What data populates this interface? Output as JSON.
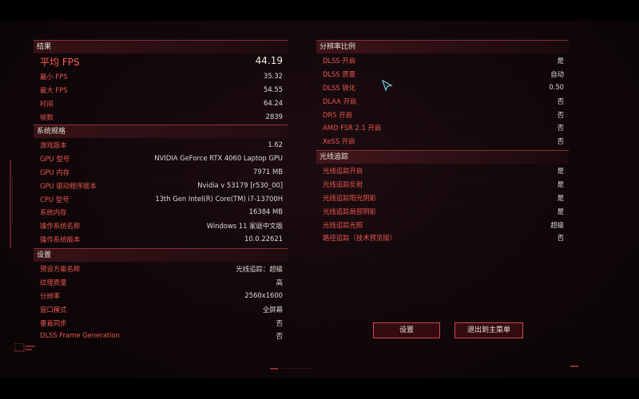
{
  "results": {
    "title": "结果",
    "main": {
      "label": "平均 FPS",
      "value": "44.19"
    },
    "rows": [
      {
        "label": "最小 FPS",
        "value": "35.32"
      },
      {
        "label": "最大 FPS",
        "value": "54.55"
      },
      {
        "label": "时间",
        "value": "64.24"
      },
      {
        "label": "帧数",
        "value": "2839"
      }
    ]
  },
  "system": {
    "title": "系统规格",
    "rows": [
      {
        "label": "游戏版本",
        "value": "1.62"
      },
      {
        "label": "GPU 型号",
        "value": "NVIDIA GeForce RTX 4060 Laptop GPU"
      },
      {
        "label": "GPU 内存",
        "value": "7971 MB"
      },
      {
        "label": "GPU 驱动程序版本",
        "value": "Nvidia v 53179 [r530_00]"
      },
      {
        "label": "CPU 型号",
        "value": "13th Gen Intel(R) Core(TM) i7-13700H"
      },
      {
        "label": "系统内存",
        "value": "16384 MB"
      },
      {
        "label": "操作系统名称",
        "value": "Windows 11 家庭中文版"
      },
      {
        "label": "操作系统版本",
        "value": "10.0.22621"
      }
    ]
  },
  "settings": {
    "title": "设置",
    "rows": [
      {
        "label": "预设方案名称",
        "value": "光线追踪：超级"
      },
      {
        "label": "纹理质量",
        "value": "高"
      },
      {
        "label": "分辨率",
        "value": "2560x1600"
      },
      {
        "label": "窗口模式",
        "value": "全屏幕"
      },
      {
        "label": "垂直同步",
        "value": "否"
      },
      {
        "label": "DLSS Frame Generation",
        "value": "否"
      }
    ]
  },
  "resolution": {
    "title": "分辨率比例",
    "rows": [
      {
        "label": "DLSS 开启",
        "value": "是"
      },
      {
        "label": "DLSS 质量",
        "value": "自动"
      },
      {
        "label": "DLSS 锐化",
        "value": "0.50"
      },
      {
        "label": "DLAA 开启",
        "value": "否"
      },
      {
        "label": "DRS 开启",
        "value": "否"
      },
      {
        "label": "AMD FSR 2.1 开启",
        "value": "否"
      },
      {
        "label": "XeSS 开启",
        "value": "否"
      }
    ]
  },
  "raytracing": {
    "title": "光线追踪",
    "rows": [
      {
        "label": "光线追踪开启",
        "value": "是"
      },
      {
        "label": "光线追踪反射",
        "value": "是"
      },
      {
        "label": "光线追踪阳光阴影",
        "value": "是"
      },
      {
        "label": "光线追踪局部阴影",
        "value": "是"
      },
      {
        "label": "光线追踪光照",
        "value": "超级"
      },
      {
        "label": "路径追踪（技术预览版）",
        "value": "否"
      }
    ]
  },
  "buttons": {
    "settings": "设置",
    "exit": "退出到主菜单"
  },
  "colors": {
    "accent_red": "#e7574f",
    "value_text": "#dcdcd6",
    "border_red": "#d5484c"
  }
}
